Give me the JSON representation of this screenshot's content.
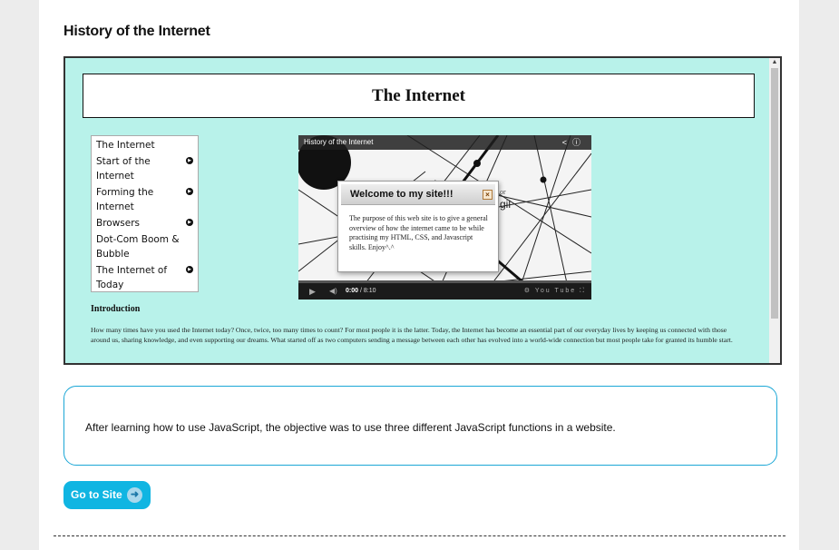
{
  "section": {
    "title": "History of the Internet"
  },
  "embed": {
    "header_title": "The Internet",
    "nav": [
      {
        "label": "The Internet",
        "has_arrow": false
      },
      {
        "label": "Start of the Internet",
        "has_arrow": true
      },
      {
        "label": "Forming the Internet",
        "has_arrow": true
      },
      {
        "label": "Browsers",
        "has_arrow": true
      },
      {
        "label": "Dot-Com Boom & Bubble",
        "has_arrow": false
      },
      {
        "label": "The Internet of Today",
        "has_arrow": true
      }
    ],
    "video": {
      "title": "History of the Internet",
      "time_current": "0:00",
      "time_total": " / 8:10",
      "bg_text_1": "or",
      "bg_text_2": "gil",
      "youtube_label": "You Tube",
      "progress": 0.0
    },
    "modal": {
      "title": "Welcome to my site!!!",
      "close_label": "×",
      "body": "The purpose of this web site is to give a general overview of how the internet came to be while practising my HTML, CSS, and Javascript skills. Enjoy^.^"
    },
    "intro_heading": "Introduction",
    "intro_text": "How many times have you used the Internet today? Once, twice, too many times to count? For most people it is the latter. Today, the Internet has become an essential part of our everyday lives by keeping us connected with those around us, sharing knowledge, and even supporting our dreams. What started off as two computers sending a message between each other has evolved into a world-wide connection but most people take for granted its humble start."
  },
  "description": "After learning how to use JavaScript, the objective was to use three different JavaScript functions in a website.",
  "button": {
    "label": "Go to Site",
    "icon": "arrow-right-icon"
  },
  "colors": {
    "frame_bg": "#b8f2ea",
    "accent": "#10b5e2",
    "box_border": "#1ba7d6"
  }
}
